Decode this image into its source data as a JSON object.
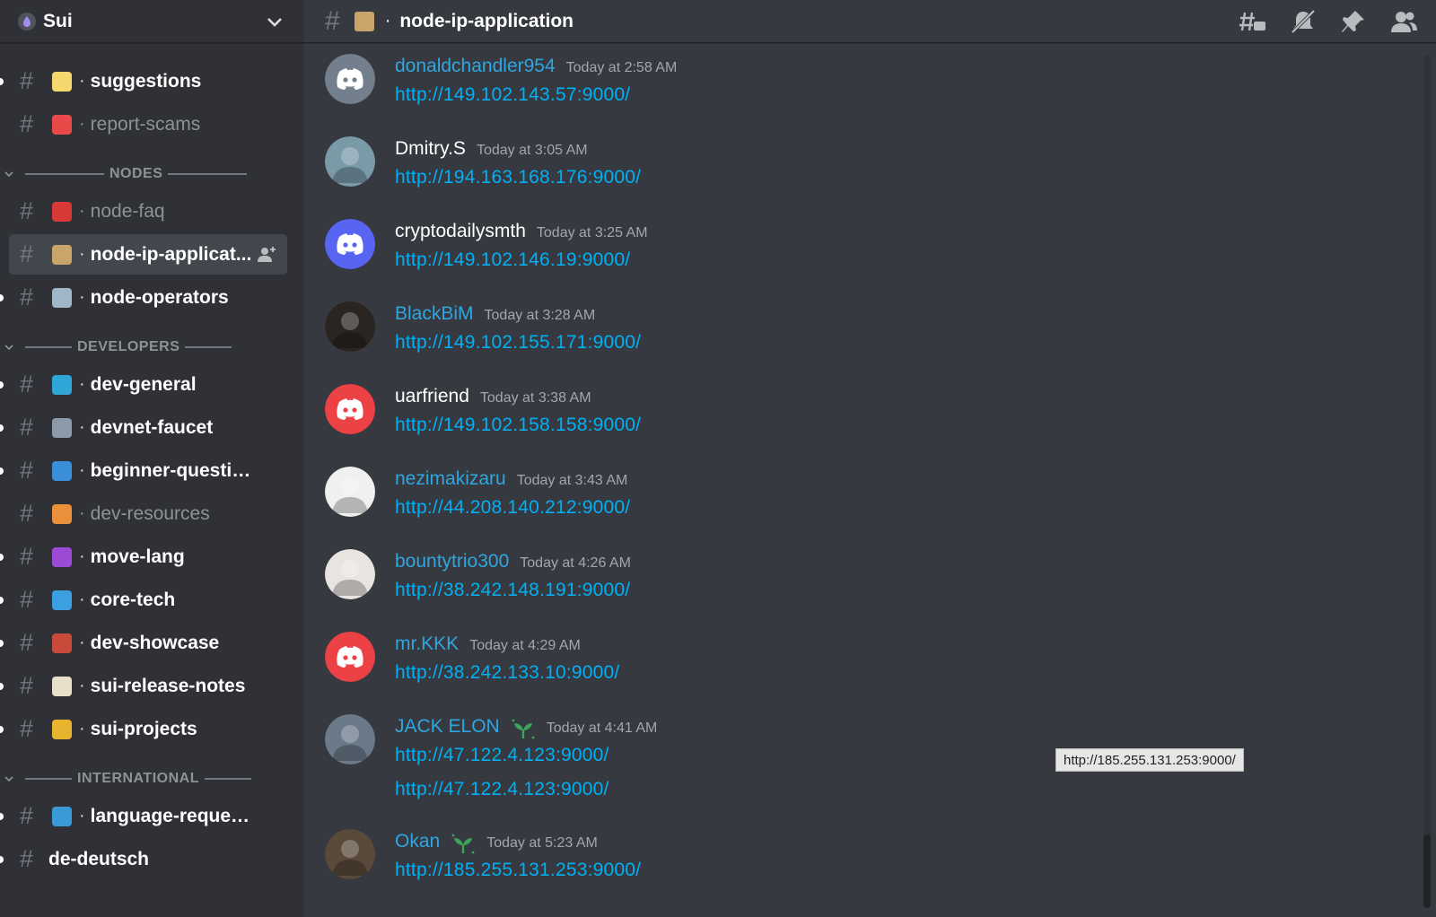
{
  "server": {
    "name": "Sui"
  },
  "sidebar": {
    "channels_top": [
      {
        "label": "suggestions",
        "emoji": "lightbulb",
        "color": "#f5d76e",
        "unread": true
      },
      {
        "label": "report-scams",
        "emoji": "siren",
        "color": "#e84a4a",
        "unread": false
      }
    ],
    "categories": [
      {
        "label": "NODES",
        "channels": [
          {
            "label": "node-faq",
            "emoji": "red-question-mark",
            "color": "#d83a3a",
            "unread": false
          },
          {
            "label": "node-ip-applicat...",
            "emoji": "clipboard",
            "color": "#c9a56a",
            "unread": false,
            "selected": true
          },
          {
            "label": "node-operators",
            "emoji": "sailboat",
            "color": "#9fb6c8",
            "unread": true
          }
        ]
      },
      {
        "label": "DEVELOPERS",
        "channels": [
          {
            "label": "dev-general",
            "emoji": "whale",
            "color": "#2fa6d6",
            "unread": true
          },
          {
            "label": "devnet-faucet",
            "emoji": "faucet",
            "color": "#8a9aa8",
            "unread": true
          },
          {
            "label": "beginner-questions",
            "emoji": "fish",
            "color": "#3b8ed8",
            "unread": true
          },
          {
            "label": "dev-resources",
            "emoji": "beach",
            "color": "#e8913a",
            "unread": false
          },
          {
            "label": "move-lang",
            "emoji": "aquarius",
            "color": "#9b4bd6",
            "unread": true
          },
          {
            "label": "core-tech",
            "emoji": "wave",
            "color": "#3aa0e0",
            "unread": true
          },
          {
            "label": "dev-showcase",
            "emoji": "ship",
            "color": "#c84a3a",
            "unread": true
          },
          {
            "label": "sui-release-notes",
            "emoji": "memo",
            "color": "#e8e0c8",
            "unread": true
          },
          {
            "label": "sui-projects",
            "emoji": "construction",
            "color": "#e8b430",
            "unread": true
          }
        ]
      },
      {
        "label": "INTERNATIONAL",
        "channels": [
          {
            "label": "language-requests",
            "emoji": "world-map",
            "color": "#3a9ad8",
            "unread": true
          },
          {
            "label": "de-deutsch",
            "emoji": "",
            "color": "",
            "unread": true
          }
        ]
      }
    ],
    "invite_icon": "add-member-icon"
  },
  "channel_header": {
    "title": "node-ip-application",
    "emoji": "clipboard",
    "icons": [
      "threads-icon",
      "mute-bell-icon",
      "pin-icon",
      "members-icon"
    ]
  },
  "messages": [
    {
      "author": "donaldchandler954",
      "author_color": "#2fa6e0",
      "time": "Today at 2:58 AM",
      "links": [
        "http://149.102.143.57:9000/"
      ],
      "avatar": "discord-gray",
      "avatar_color": "#747f8d",
      "badge": false
    },
    {
      "author": "Dmitry.S",
      "author_color": "#ffffff",
      "time": "Today at 3:05 AM",
      "links": [
        "http://194.163.168.176:9000/"
      ],
      "avatar": "photo-beach",
      "avatar_color": "#7a9aa8",
      "badge": false
    },
    {
      "author": "cryptodailysmth",
      "author_color": "#ffffff",
      "time": "Today at 3:25 AM",
      "links": [
        "http://149.102.146.19:9000/"
      ],
      "avatar": "discord-blurple",
      "avatar_color": "#5865f2",
      "badge": false
    },
    {
      "author": "BlackBiM",
      "author_color": "#2fa6e0",
      "time": "Today at 3:28 AM",
      "links": [
        "http://149.102.155.171:9000/"
      ],
      "avatar": "photo-cat",
      "avatar_color": "#2a2520",
      "badge": false
    },
    {
      "author": "uarfriend",
      "author_color": "#ffffff",
      "time": "Today at 3:38 AM",
      "links": [
        "http://149.102.158.158:9000/"
      ],
      "avatar": "discord-red",
      "avatar_color": "#ed4245",
      "badge": false
    },
    {
      "author": "nezimakizaru",
      "author_color": "#2fa6e0",
      "time": "Today at 3:43 AM",
      "links": [
        "http://44.208.140.212:9000/"
      ],
      "avatar": "photo-seal",
      "avatar_color": "#f0f0f0",
      "badge": false
    },
    {
      "author": "bountytrio300",
      "author_color": "#2fa6e0",
      "time": "Today at 4:26 AM",
      "links": [
        "http://38.242.148.191:9000/"
      ],
      "avatar": "photo-anime",
      "avatar_color": "#e8e4e0",
      "badge": false
    },
    {
      "author": "mr.KKK",
      "author_color": "#2fa6e0",
      "time": "Today at 4:29 AM",
      "links": [
        "http://38.242.133.10:9000/"
      ],
      "avatar": "discord-red",
      "avatar_color": "#ed4245",
      "badge": false
    },
    {
      "author": "JACK ELON",
      "author_color": "#2fa6e0",
      "time": "Today at 4:41 AM",
      "links": [
        "http://47.122.4.123:9000/",
        "http://47.122.4.123:9000/"
      ],
      "avatar": "photo-woman",
      "avatar_color": "#6a7a8a",
      "badge": true
    },
    {
      "author": "Okan",
      "author_color": "#2fa6e0",
      "time": "Today at 5:23 AM",
      "links": [
        "http://185.255.131.253:9000/"
      ],
      "avatar": "photo-man",
      "avatar_color": "#5a4a3a",
      "badge": true
    }
  ],
  "tooltip": "http://185.255.131.253:9000/",
  "colors": {
    "link": "#00b0f4",
    "sidebar_bg": "#2f3136",
    "main_bg": "#36393f",
    "selected_bg": "#42464d"
  }
}
